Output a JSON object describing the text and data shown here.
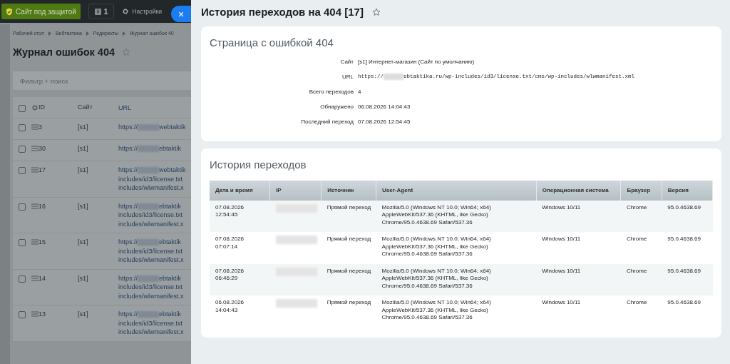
{
  "topbar": {
    "protect_button": "Сайт под защитой",
    "notify_count": "1",
    "settings": "Настройки",
    "close": "×"
  },
  "background_page": {
    "breadcrumbs": [
      "Рабочий стол",
      "Вебтактика",
      "Редиректы",
      "Журнал ошибок 40"
    ],
    "title": "Журнал ошибок 404",
    "filter": {
      "placeholder": "Фильтр + поиск"
    },
    "columns": [
      "ID",
      "Сайт",
      "URL"
    ],
    "header_checked": false,
    "rows": [
      {
        "checked": false,
        "id": "3",
        "site": "[s1]",
        "url": [
          "https://",
          "webtaktik"
        ]
      },
      {
        "checked": false,
        "id": "30",
        "site": "[s1]",
        "url": [
          "https://",
          "ebtaktik"
        ]
      },
      {
        "checked": false,
        "id": "17",
        "site": "[s1]",
        "url": [
          "https://",
          "webtaktik",
          "includes/id3/license.txt",
          "includes/wlwmanifest.x"
        ]
      },
      {
        "checked": false,
        "id": "16",
        "site": "[s1]",
        "url": [
          "https://",
          "ebtaktik",
          "includes/id3/license.txt",
          "includes/wlwmanifest.x"
        ]
      },
      {
        "checked": false,
        "id": "15",
        "site": "[s1]",
        "url": [
          "https://",
          "ebtaktik",
          "includes/id3/license.txt",
          "includes/wlwmanifest.x"
        ]
      },
      {
        "checked": false,
        "id": "14",
        "site": "[s1]",
        "url": [
          "https://",
          "ebtaktik",
          "includes/id3/license.txt",
          "includes/wlwmanifest.x"
        ]
      },
      {
        "checked": false,
        "id": "13",
        "site": "[s1]",
        "url": [
          "https://",
          "ebtaktik",
          "includes/id3/license.txt",
          "includes/wlwmanifest.x"
        ]
      }
    ]
  },
  "panel": {
    "title": "История переходов на 404 [17]",
    "info": {
      "heading": "Страница с ошибкой 404",
      "fields": [
        {
          "label": "Сайт",
          "value": "[s1] Интернет-магазин (Сайт по умолчанию)"
        },
        {
          "label": "URL",
          "kind": "url",
          "prefix": "https://",
          "value": "ebtaktika.ru/wp-includes/id3/license.txt/cms/wp-includes/wlwmanifest.xml"
        },
        {
          "label": "Всего переходов",
          "value": "4"
        },
        {
          "label": "Обнаружено",
          "value": "06.08.2026 14:04:43"
        },
        {
          "label": "Последний переход",
          "value": "07.08.2026 12:54:45"
        }
      ]
    },
    "history": {
      "heading": "История переходов",
      "columns": [
        "Дата и время",
        "IP",
        "Источник",
        "User-Agent",
        "Операционная система",
        "Браузер",
        "Версия"
      ],
      "rows": [
        {
          "date": "07.08.2026",
          "time": "12:54:45",
          "source": "Прямой переход",
          "user_agent": "Mozilla/5.0 (Windows NT 10.0; Win64; x64) AppleWebKit/537.36 (KHTML, like Gecko) Chrome/95.0.4638.69 Safari/537.36",
          "os": "Windows 10/11",
          "browser": "Chrome",
          "version": "95.0.4638.69"
        },
        {
          "date": "07.08.2026",
          "time": "07:07:14",
          "source": "Прямой переход",
          "user_agent": "Mozilla/5.0 (Windows NT 10.0; Win64; x64) AppleWebKit/537.36 (KHTML, like Gecko) Chrome/95.0.4638.69 Safari/537.36",
          "os": "Windows 10/11",
          "browser": "Chrome",
          "version": "95.0.4638.69"
        },
        {
          "date": "07.08.2026",
          "time": "06:46:29",
          "source": "Прямой переход",
          "user_agent": "Mozilla/5.0 (Windows NT 10.0; Win64; x64) AppleWebKit/537.36 (KHTML, like Gecko) Chrome/95.0.4638.69 Safari/537.36",
          "os": "Windows 10/11",
          "browser": "Chrome",
          "version": "95.0.4638.69"
        },
        {
          "date": "06.08.2026",
          "time": "14:04:43",
          "source": "Прямой переход",
          "user_agent": "Mozilla/5.0 (Windows NT 10.0; Win64; x64) AppleWebKit/537.36 (KHTML, like Gecko) Chrome/95.0.4638.69 Safari/537.36",
          "os": "Windows 10/11",
          "browser": "Chrome",
          "version": "95.0.4638.69"
        }
      ]
    }
  }
}
